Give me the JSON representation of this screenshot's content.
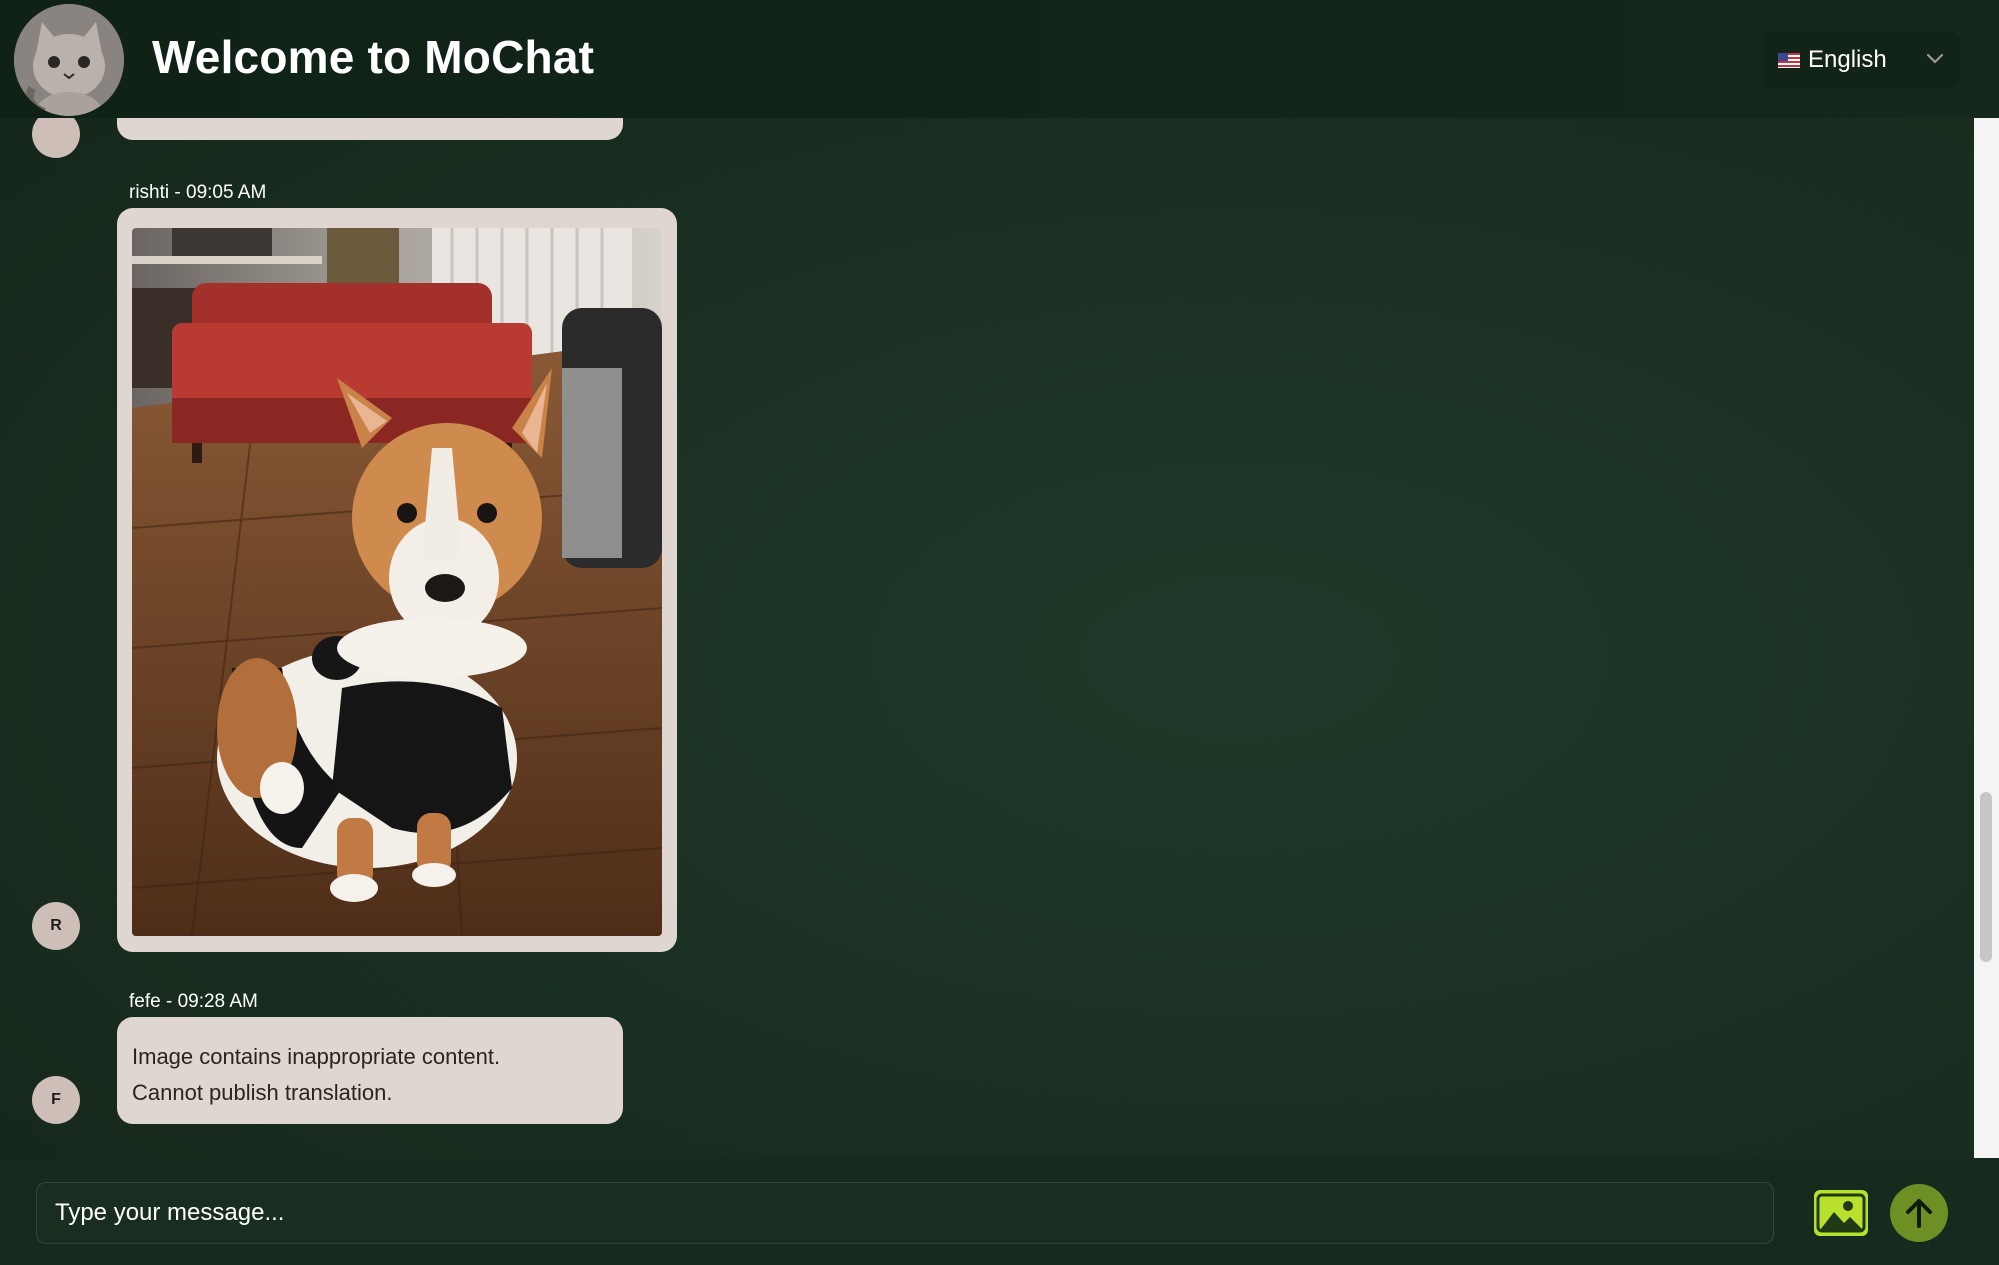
{
  "header": {
    "title": "Welcome to MoChat",
    "language": "English"
  },
  "messages": [
    {
      "author_time": "rishti - 09:05 AM",
      "avatar_initial": "R",
      "type": "image"
    },
    {
      "author_time": "fefe - 09:28 AM",
      "avatar_initial": "F",
      "type": "text",
      "line1": "Image contains inappropriate content.",
      "line2": "Cannot publish translation."
    }
  ],
  "composer": {
    "placeholder": "Type your message..."
  },
  "colors": {
    "header_bg": "#102216",
    "chat_bg": "#1a3023",
    "bubble": "#e0d6d1",
    "image_button": "#b8e02c",
    "send_button": "#6d8f24"
  },
  "icons": {
    "language": "us-flag-icon",
    "dropdown": "chevron-down-icon",
    "image_upload": "image-icon",
    "send": "arrow-up-icon"
  }
}
